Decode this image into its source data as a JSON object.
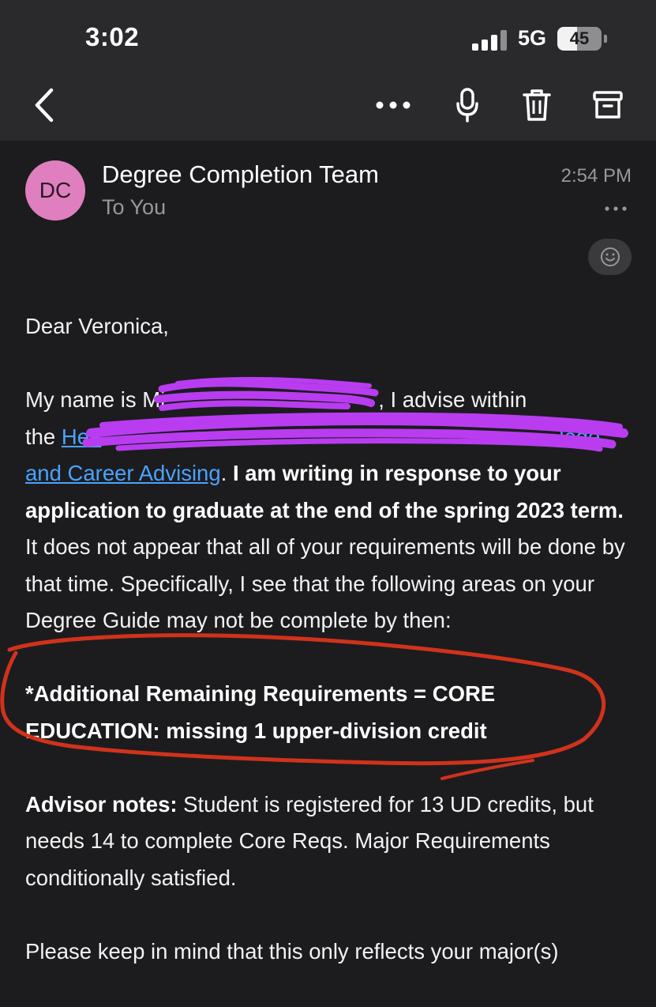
{
  "status_bar": {
    "time": "3:02",
    "network": "5G",
    "battery": "45",
    "battery_level": 0.45
  },
  "toolbar": {
    "icons": [
      "back-chevron-icon",
      "more-icon",
      "microphone-icon",
      "trash-icon",
      "archive-icon"
    ]
  },
  "email": {
    "avatar_initials": "DC",
    "avatar_color": "#e07fc0",
    "sender": "Degree Completion Team",
    "recipient": "To You",
    "time": "2:54 PM",
    "reaction_icon": "smiley-icon"
  },
  "body": {
    "greeting": "Dear Veronica,",
    "p1_a": "My name is Mi",
    "p1_b": ", I advise within",
    "p1_c": "the ",
    "p1_link_a": "Hea",
    "p1_link_b": "lege",
    "p1_link_c": "and Career Advising",
    "p1_d": ". ",
    "p1_bold": "I am writing in response to your application to graduate at the end of the spring 2023 term.",
    "p1_e": " It does not appear that all of your requirements will be done by that time. Specifically, I see that the following areas on your Degree Guide may not be complete by then:",
    "requirement": "*Additional Remaining Requirements = CORE EDUCATION: missing 1 upper-division credit",
    "notes_label": "Advisor notes:",
    "notes_text": " Student is registered for 13 UD credits, but needs 14 to complete Core Reqs. Major Requirements conditionally satisfied.",
    "p_last": "Please keep in mind that this only reflects your major(s)"
  },
  "colors": {
    "background": "#1c1c1e",
    "toolbar": "#2a2a2c",
    "link": "#4aa3ff",
    "redaction": "#b93cf0",
    "annotation_circle": "#d0321c"
  }
}
